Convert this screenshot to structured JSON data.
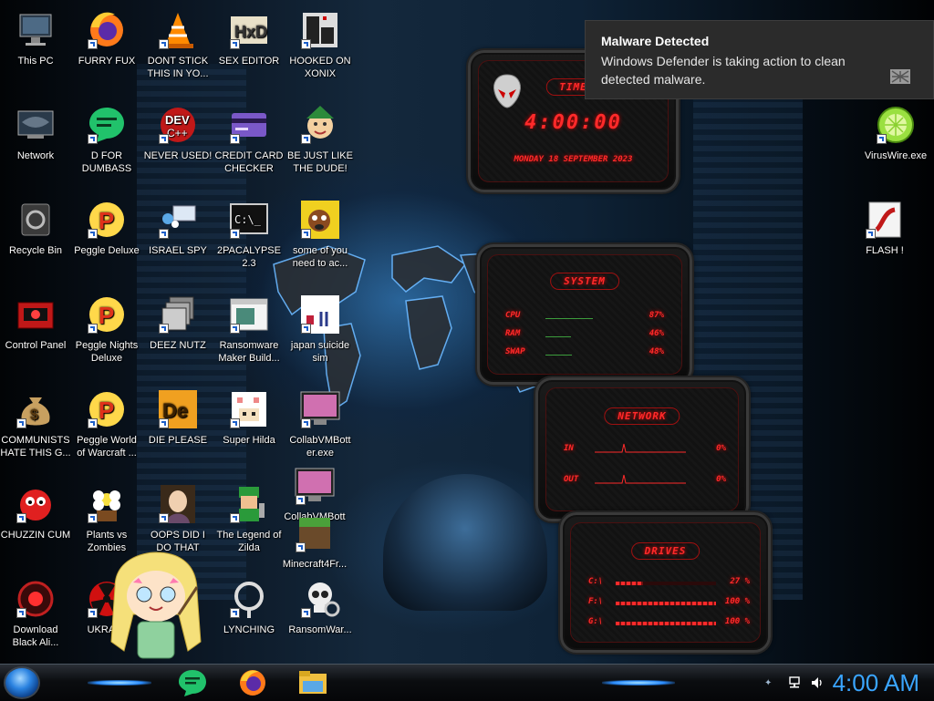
{
  "notification": {
    "title": "Malware Detected",
    "message": "Windows Defender is taking action to clean detected malware."
  },
  "desktop": {
    "icons": [
      {
        "label": "This PC",
        "icon": "computer-icon"
      },
      {
        "label": "FURRY FUX",
        "icon": "firefox-icon"
      },
      {
        "label": "DONT STICK THIS IN YO...",
        "icon": "vlc-cone-icon"
      },
      {
        "label": "SEX EDITOR",
        "icon": "hxd-icon"
      },
      {
        "label": "HOOKED ON XONIX",
        "icon": "xonix-icon"
      },
      {
        "label": "Network",
        "icon": "network-icon"
      },
      {
        "label": "D FOR DUMBASS",
        "icon": "chat-bubble-icon"
      },
      {
        "label": "NEVER USED!",
        "icon": "devcpp-icon"
      },
      {
        "label": "CREDIT CARD CHECKER",
        "icon": "credit-card-icon"
      },
      {
        "label": "BE JUST LIKE THE DUDE!",
        "icon": "elf-icon"
      },
      {
        "label": "Recycle Bin",
        "icon": "recycle-bin-icon"
      },
      {
        "label": "Peggle Deluxe",
        "icon": "peggle-icon"
      },
      {
        "label": "ISRAEL SPY",
        "icon": "spy-icon"
      },
      {
        "label": "2PACALYPSE 2.3",
        "icon": "terminal-icon"
      },
      {
        "label": "some of you need to ac...",
        "icon": "dog-icon"
      },
      {
        "label": "Control Panel",
        "icon": "control-panel-icon"
      },
      {
        "label": "Peggle Nights Deluxe",
        "icon": "peggle-icon"
      },
      {
        "label": "DEEZ NUTZ",
        "icon": "windows-stack-icon"
      },
      {
        "label": "Ransomware Maker Build...",
        "icon": "app-window-icon"
      },
      {
        "label": "japan suicide sim",
        "icon": "japan-sim-icon"
      },
      {
        "label": "COMMUNISTS HATE THIS G...",
        "icon": "money-bag-icon"
      },
      {
        "label": "Peggle World of Warcraft ...",
        "icon": "peggle-icon"
      },
      {
        "label": "DIE PLEASE",
        "icon": "de-icon"
      },
      {
        "label": "Super Hilda",
        "icon": "pixel-cat-icon"
      },
      {
        "label": "CollabVMBott er.exe",
        "icon": "monitor-pink-icon"
      },
      {
        "label": "CHUZZIN CUM",
        "icon": "chuzzle-icon"
      },
      {
        "label": "Plants vs Zombies",
        "icon": "flower-icon"
      },
      {
        "label": "OOPS DID I DO THAT",
        "icon": "portrait-icon"
      },
      {
        "label": "The Legend of Zilda",
        "icon": "link-sprite-icon"
      },
      {
        "label": "CollabVMBott er.exe",
        "icon": "monitor-pink-icon"
      },
      {
        "label": "Download Black Ali...",
        "icon": "alien-disc-icon"
      },
      {
        "label": "UKRAI...",
        "icon": "radiation-icon"
      },
      {
        "label": "LYNCHING",
        "icon": "rope-icon"
      },
      {
        "label": "RansomWar...",
        "icon": "skull-icon"
      },
      {
        "label": "Minecraft4Fr...",
        "icon": "minecraft-icon"
      },
      {
        "label": "VirusWire.exe",
        "icon": "lime-icon"
      },
      {
        "label": "FLASH !",
        "icon": "flash-icon"
      }
    ]
  },
  "gadgets": {
    "time": {
      "title": "TIME",
      "clock": "4:00:00",
      "date": "MONDAY 18 SEPTEMBER 2023"
    },
    "system": {
      "title": "SYSTEM",
      "rows": [
        {
          "label": "CPU",
          "value": "87%",
          "level": 0.87
        },
        {
          "label": "RAM",
          "value": "46%",
          "level": 0.46
        },
        {
          "label": "SWAP",
          "value": "48%",
          "level": 0.48
        }
      ]
    },
    "network": {
      "title": "NETWORK",
      "rows": [
        {
          "label": "IN",
          "value": "0%"
        },
        {
          "label": "OUT",
          "value": "0%"
        }
      ]
    },
    "drives": {
      "title": "DRIVES",
      "rows": [
        {
          "label": "C:\\",
          "value": "27 %",
          "level": 0.27
        },
        {
          "label": "F:\\",
          "value": "100 %",
          "level": 1.0
        },
        {
          "label": "G:\\",
          "value": "100 %",
          "level": 1.0
        }
      ]
    }
  },
  "taskbar": {
    "apps": [
      "chat-bubble-icon",
      "firefox-icon",
      "file-explorer-icon"
    ],
    "clock": "4:00 AM"
  },
  "colors": {
    "gadget_red": "#ff2a2a",
    "clock_blue": "#3aa5ff",
    "toast_bg": "#2b2b2b"
  }
}
